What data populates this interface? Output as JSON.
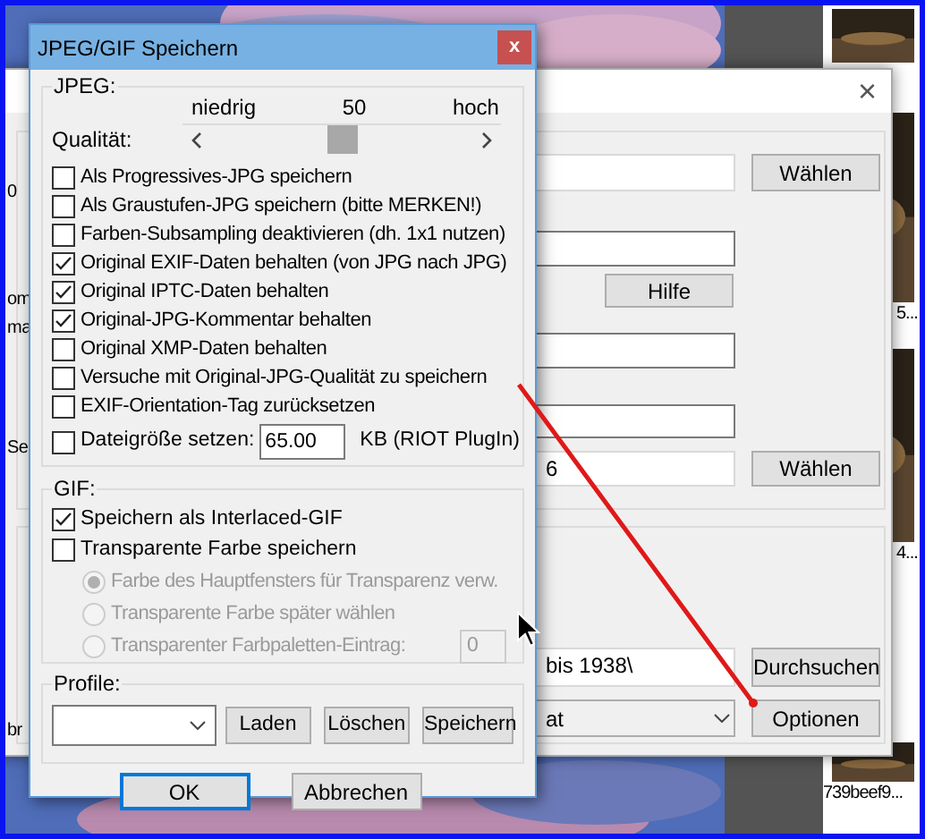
{
  "thumbnails": [
    {
      "caption": "5..."
    },
    {
      "caption": "4..."
    },
    {
      "caption": "739beef9..."
    }
  ],
  "background_window": {
    "close": "×",
    "cut_labels": [
      "0",
      "om",
      "ma",
      "Se",
      "br"
    ],
    "rows": [
      {
        "kind": "field_button",
        "button": "Wählen"
      },
      {
        "kind": "field"
      },
      {
        "kind": "button",
        "button": "Hilfe"
      },
      {
        "kind": "field"
      },
      {
        "kind": "field"
      },
      {
        "kind": "field_button",
        "value": "6",
        "button": "Wählen"
      },
      {
        "kind": "field_button",
        "value": "bis 1938\\",
        "button": "Durchsuchen"
      },
      {
        "kind": "dropdown_button",
        "value": "at",
        "button": "Optionen"
      }
    ]
  },
  "dialog": {
    "title": "JPEG/GIF Speichern",
    "close": "x",
    "jpeg": {
      "label": "JPEG:",
      "quality": {
        "label": "Qualität:",
        "low": "niedrig",
        "value": "50",
        "high": "hoch",
        "level": 0.5
      },
      "options": [
        {
          "label": "Als Progressives-JPG speichern",
          "checked": false
        },
        {
          "label": "Als Graustufen-JPG speichern (bitte MERKEN!)",
          "checked": false
        },
        {
          "label": "Farben-Subsampling deaktivieren (dh. 1x1 nutzen)",
          "checked": false
        },
        {
          "label": "Original EXIF-Daten behalten (von JPG nach JPG)",
          "checked": true
        },
        {
          "label": "Original IPTC-Daten behalten",
          "checked": true
        },
        {
          "label": "Original-JPG-Kommentar behalten",
          "checked": true
        },
        {
          "label": "Original XMP-Daten behalten",
          "checked": false
        },
        {
          "label": "Versuche mit Original-JPG-Qualität zu speichern",
          "checked": false
        },
        {
          "label": "EXIF-Orientation-Tag zurücksetzen",
          "checked": false
        }
      ],
      "filesize": {
        "label": "Dateigröße setzen:",
        "checked": false,
        "value": "65.00",
        "unit": "KB (RIOT PlugIn)"
      }
    },
    "gif": {
      "label": "GIF:",
      "options": [
        {
          "label": "Speichern als Interlaced-GIF",
          "checked": true
        },
        {
          "label": "Transparente Farbe speichern",
          "checked": false
        }
      ],
      "transparency": [
        {
          "label": "Farbe des Hauptfensters für Transparenz verw.",
          "selected": true,
          "disabled": true
        },
        {
          "label": "Transparente Farbe später wählen",
          "selected": false,
          "disabled": true
        },
        {
          "label": "Transparenter Farbpaletten-Eintrag:",
          "selected": false,
          "disabled": true
        }
      ],
      "palette_entry": {
        "value": "0",
        "disabled": true
      }
    },
    "profiles": {
      "label": "Profile:",
      "buttons": [
        "Laden",
        "Löschen",
        "Speichern"
      ]
    },
    "buttons": [
      {
        "label": "OK",
        "default": true
      },
      {
        "label": "Abbrechen",
        "default": false
      }
    ]
  }
}
